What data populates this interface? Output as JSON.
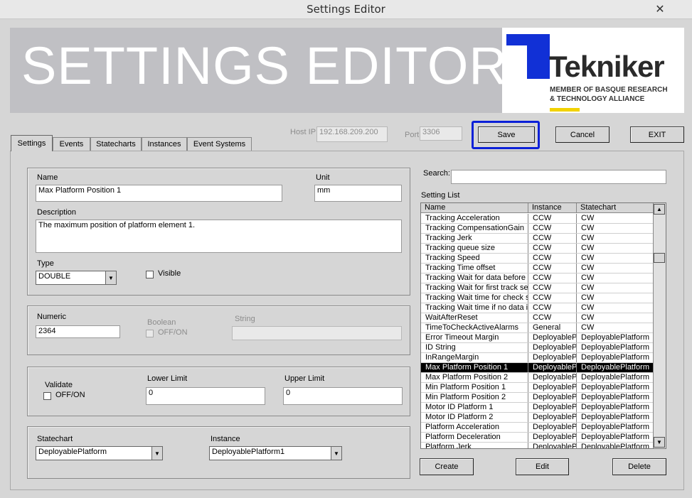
{
  "window": {
    "title": "Settings Editor",
    "close_glyph": "✕"
  },
  "banner": {
    "title": "SETTINGS EDITOR",
    "logo_name": "Tekniker",
    "logo_sub1": "MEMBER OF BASQUE RESEARCH",
    "logo_sub2": "& TECHNOLOGY ALLIANCE",
    "logo_color": "#1130d6",
    "logo_bar_color": "#f2d200"
  },
  "connection": {
    "host_label": "Host IP",
    "host_value": "192.168.209.200",
    "port_label": "Port",
    "port_value": "3306"
  },
  "toolbar": {
    "save": "Save",
    "cancel": "Cancel",
    "exit": "EXIT",
    "highlight_color": "#0b20d8"
  },
  "tabs": [
    {
      "label": "Settings",
      "active": true
    },
    {
      "label": "Events"
    },
    {
      "label": "Statecharts"
    },
    {
      "label": "Instances"
    },
    {
      "label": "Event Systems"
    }
  ],
  "form": {
    "name_label": "Name",
    "name_value": "Max Platform Position 1",
    "unit_label": "Unit",
    "unit_value": "mm",
    "description_label": "Description",
    "description_value": "The maximum position of platform element 1.",
    "type_label": "Type",
    "type_value": "DOUBLE",
    "visible_label": "Visible",
    "numeric_label": "Numeric",
    "numeric_value": "2364",
    "boolean_label": "Boolean",
    "boolean_onoff": "OFF/ON",
    "string_label": "String",
    "validate_label": "Validate",
    "validate_onoff": "OFF/ON",
    "lower_label": "Lower Limit",
    "lower_value": "0",
    "upper_label": "Upper Limit",
    "upper_value": "0",
    "statechart_label": "Statechart",
    "statechart_value": "DeployablePlatform",
    "instance_label": "Instance",
    "instance_value": "DeployablePlatform1"
  },
  "list": {
    "search_label": "Search:",
    "list_label": "Setting List",
    "columns": [
      "Name",
      "Instance",
      "Statechart"
    ],
    "rows": [
      [
        "Tracking Acceleration",
        "CCW",
        "CW"
      ],
      [
        "Tracking CompensationGain",
        "CCW",
        "CW"
      ],
      [
        "Tracking Jerk",
        "CCW",
        "CW"
      ],
      [
        "Tracking queue size",
        "CCW",
        "CW"
      ],
      [
        "Tracking Speed",
        "CCW",
        "CW"
      ],
      [
        "Tracking Time offset",
        "CCW",
        "CW"
      ],
      [
        "Tracking Wait for data before e",
        "CCW",
        "CW"
      ],
      [
        "Tracking Wait for first track setp",
        "CCW",
        "CW"
      ],
      [
        "Tracking Wait time for check se",
        "CCW",
        "CW"
      ],
      [
        "Tracking Wait time if no data in",
        "CCW",
        "CW"
      ],
      [
        "WaitAfterReset",
        "CCW",
        "CW"
      ],
      [
        "TimeToCheckActiveAlarms",
        "General",
        "CW"
      ],
      [
        "Error Timeout Margin",
        "DeployableP",
        "DeployablePlatform"
      ],
      [
        "ID String",
        "DeployableP",
        "DeployablePlatform"
      ],
      [
        "InRangeMargin",
        "DeployableP",
        "DeployablePlatform"
      ],
      [
        "Max Platform Position 1",
        "DeployableP",
        "DeployablePlatform"
      ],
      [
        "Max Platform Position 2",
        "DeployableP",
        "DeployablePlatform"
      ],
      [
        "Min Platform Position 1",
        "DeployableP",
        "DeployablePlatform"
      ],
      [
        "Min Platform Position 2",
        "DeployableP",
        "DeployablePlatform"
      ],
      [
        "Motor ID Platform 1",
        "DeployableP",
        "DeployablePlatform"
      ],
      [
        "Motor ID Platform 2",
        "DeployableP",
        "DeployablePlatform"
      ],
      [
        "Platform Acceleration",
        "DeployableP",
        "DeployablePlatform"
      ],
      [
        "Platform Deceleration",
        "DeployableP",
        "DeployablePlatform"
      ],
      [
        "Platform Jerk",
        "DeployableP",
        "DeployablePlatform"
      ]
    ],
    "selected_index": 15,
    "create": "Create",
    "edit": "Edit",
    "delete": "Delete"
  }
}
